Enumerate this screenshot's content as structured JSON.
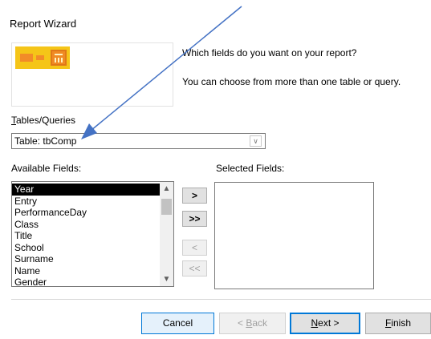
{
  "window": {
    "title": "Report Wizard"
  },
  "instructions": {
    "question": "Which fields do you want on your report?",
    "hint": "You can choose from more than one table or query."
  },
  "tables_queries": {
    "label_first": "T",
    "label_rest": "ables/Queries",
    "selected_value": "Table: tbComp",
    "dropdown_icon": "chevron-down-icon"
  },
  "available_fields": {
    "label": "Available Fields:",
    "items": [
      "Year",
      "Entry",
      "PerformanceDay",
      "Class",
      "Title",
      "School",
      "Surname",
      "Name",
      "Gender"
    ],
    "selected_index": 0
  },
  "selected_fields": {
    "label": "Selected Fields:",
    "items": []
  },
  "move_buttons": {
    "add": ">",
    "add_all": ">>",
    "remove": "<",
    "remove_all": "<<"
  },
  "footer_buttons": {
    "cancel": "Cancel",
    "back_prefix": "< ",
    "back_accel": "B",
    "back_rest": "ack",
    "next_accel": "N",
    "next_rest": "ext >",
    "finish_accel": "F",
    "finish_rest": "inish"
  },
  "colors": {
    "wizard_graphic": "#f5c518",
    "accent": "#0078d7",
    "annotation_arrow": "#4472c4"
  }
}
